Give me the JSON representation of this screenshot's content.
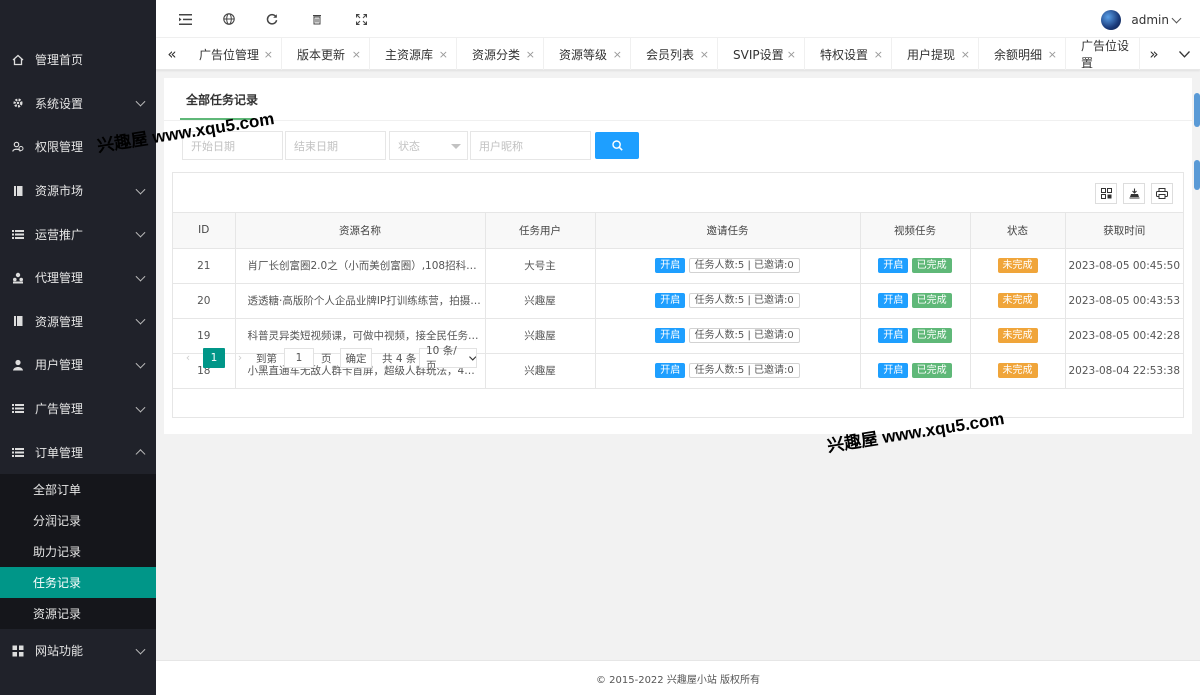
{
  "sidebar": {
    "items": [
      {
        "label": "管理首页",
        "icon": "home-icon",
        "arrow": false
      },
      {
        "label": "系统设置",
        "icon": "gear-icon",
        "arrow": true
      },
      {
        "label": "权限管理",
        "icon": "users-icon",
        "arrow": false
      },
      {
        "label": "资源市场",
        "icon": "book-icon",
        "arrow": true
      },
      {
        "label": "运营推广",
        "icon": "list-icon",
        "arrow": true
      },
      {
        "label": "代理管理",
        "icon": "group-icon",
        "arrow": true
      },
      {
        "label": "资源管理",
        "icon": "book-icon",
        "arrow": true
      },
      {
        "label": "用户管理",
        "icon": "user-icon",
        "arrow": true
      },
      {
        "label": "广告管理",
        "icon": "list-icon",
        "arrow": true
      },
      {
        "label": "订单管理",
        "icon": "list-icon",
        "arrow": true,
        "open": true
      }
    ],
    "submenu": [
      "全部订单",
      "分润记录",
      "助力记录",
      "任务记录",
      "资源记录"
    ],
    "active_sub": "任务记录",
    "last_item": {
      "label": "网站功能",
      "icon": "grid-icon"
    }
  },
  "header": {
    "icons": [
      "menu-fold-icon",
      "globe-icon",
      "refresh-icon",
      "clear-icon",
      "fullscreen-icon"
    ],
    "username": "admin"
  },
  "tabs": [
    "广告位管理",
    "版本更新",
    "主资源库",
    "资源分类",
    "资源等级",
    "会员列表",
    "SVIP设置",
    "特权设置",
    "用户提现",
    "余额明细",
    "广告位设置"
  ],
  "card": {
    "tab_label": "全部任务记录",
    "filters": {
      "start_date_placeholder": "开始日期",
      "end_date_placeholder": "结束日期",
      "status_placeholder": "状态",
      "nickname_placeholder": "用户昵称"
    },
    "table": {
      "headers": [
        "ID",
        "资源名称",
        "任务用户",
        "邀请任务",
        "视频任务",
        "状态",
        "获取时间"
      ],
      "rows": [
        {
          "id": "21",
          "name": "肖厂长创富圈2.0之（小而美创富圈）,108招科学创...",
          "user": "大号主",
          "invite_open": "开启",
          "invite_info": "任务人数:5 | 已邀请:0",
          "video_open": "开启",
          "video_done": "已完成",
          "status": "未完成",
          "time": "2023-08-05 00:45:50"
        },
        {
          "id": "20",
          "name": "透透糖·高版阶个人企品业牌IP打训练练营，拍摄剪...",
          "user": "兴趣屋",
          "invite_open": "开启",
          "invite_info": "任务人数:5 | 已邀请:0",
          "video_open": "开启",
          "video_done": "已完成",
          "status": "未完成",
          "time": "2023-08-05 00:43:53"
        },
        {
          "id": "19",
          "name": "科普灵异类短视频课，可做中视频，接全民任务，可...",
          "user": "兴趣屋",
          "invite_open": "开启",
          "invite_info": "任务人数:5 | 已邀请:0",
          "video_open": "开启",
          "video_done": "已完成",
          "status": "未完成",
          "time": "2023-08-05 00:42:28"
        },
        {
          "id": "18",
          "name": "小黑直通车无敌人群卡首屏，超级人群玩法，4天点...",
          "user": "兴趣屋",
          "invite_open": "开启",
          "invite_info": "任务人数:5 | 已邀请:0",
          "video_open": "开启",
          "video_done": "已完成",
          "status": "未完成",
          "time": "2023-08-04 22:53:38"
        }
      ]
    },
    "pager": {
      "current": "1",
      "goto_label": "到第",
      "goto_value": "1",
      "page_unit": "页",
      "confirm": "确定",
      "total": "共 4 条",
      "per_page": "10 条/页"
    }
  },
  "footer": "© 2015-2022 兴趣屋小站 版权所有",
  "watermark": "兴趣屋 www.xqu5.com",
  "colors": {
    "sidebar": "#20222a",
    "active": "#009688",
    "primary": "#1E9FFF",
    "success": "#5FB878",
    "warning": "#f0a53a"
  }
}
